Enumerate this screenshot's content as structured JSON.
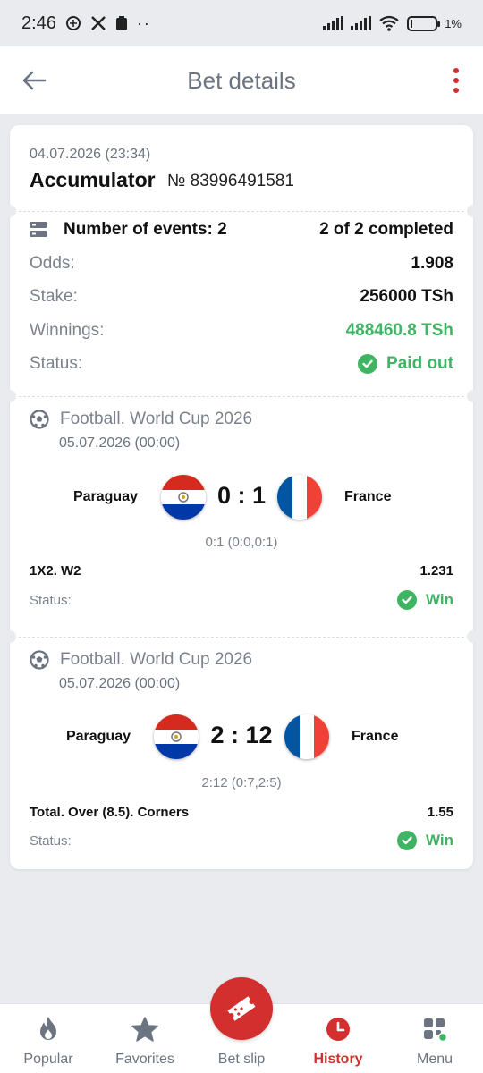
{
  "status_bar": {
    "time": "2:46",
    "battery": "1%"
  },
  "header": {
    "title": "Bet details"
  },
  "bet": {
    "date": "04.07.2026 (23:34)",
    "type": "Accumulator",
    "number": "№ 83996491581",
    "events_label": "Number of events: 2",
    "completed": "2 of 2 completed",
    "odds_label": "Odds:",
    "odds": "1.908",
    "stake_label": "Stake:",
    "stake": "256000 TSh",
    "winnings_label": "Winnings:",
    "winnings": "488460.8 TSh",
    "status_label": "Status:",
    "status": "Paid out"
  },
  "events": [
    {
      "league": "Football. World Cup 2026",
      "date": "05.07.2026 (00:00)",
      "home": "Paraguay",
      "away": "France",
      "score": "0 : 1",
      "period": "0:1 (0:0,0:1)",
      "market": "1X2. W2",
      "odds": "1.231",
      "status_label": "Status:",
      "status": "Win"
    },
    {
      "league": "Football. World Cup 2026",
      "date": "05.07.2026 (00:00)",
      "home": "Paraguay",
      "away": "France",
      "score": "2 : 12",
      "period": "2:12 (0:7,2:5)",
      "market": "Total. Over (8.5). Corners",
      "odds": "1.55",
      "status_label": "Status:",
      "status": "Win"
    }
  ],
  "nav": {
    "popular": "Popular",
    "favorites": "Favorites",
    "bet_slip": "Bet slip",
    "history": "History",
    "menu": "Menu"
  },
  "colors": {
    "accent": "#d32f2f",
    "success": "#3fb463",
    "muted": "#7b828d"
  }
}
